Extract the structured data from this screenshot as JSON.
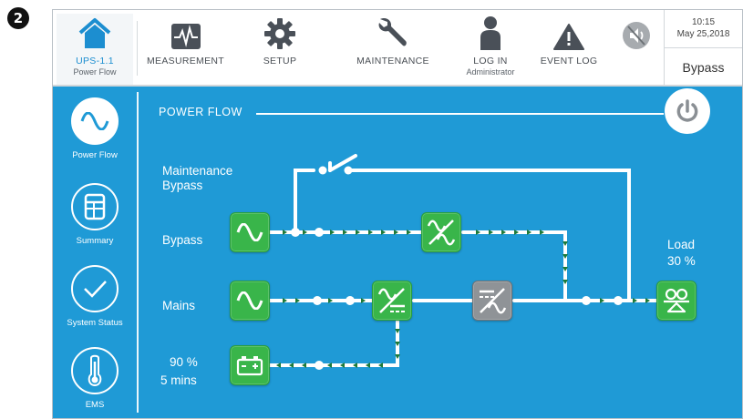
{
  "step_badge": "2",
  "topbar": {
    "items": [
      {
        "label": "UPS-1.1",
        "sublabel": "Power Flow",
        "icon": "home-icon",
        "active": true
      },
      {
        "label": "MEASUREMENT",
        "icon": "waveform-icon"
      },
      {
        "label": "SETUP",
        "icon": "gear-icon"
      },
      {
        "label": "MAINTENANCE",
        "icon": "wrench-icon"
      },
      {
        "label": "LOG IN",
        "sublabel": "Administrator",
        "icon": "user-icon"
      },
      {
        "label": "EVENT LOG",
        "icon": "warning-icon"
      },
      {
        "icon": "mute-icon"
      }
    ],
    "time": "10:15",
    "date": "May 25,2018",
    "mode": "Bypass"
  },
  "sidebar": {
    "items": [
      {
        "label": "Power Flow",
        "icon": "sine-wave-icon",
        "active": true
      },
      {
        "label": "Summary",
        "icon": "summary-table-icon"
      },
      {
        "label": "System Status",
        "icon": "checkmark-icon"
      },
      {
        "label": "EMS",
        "icon": "thermometer-icon"
      }
    ]
  },
  "power_flow": {
    "title": "POWER FLOW",
    "labels": {
      "maintenance_bypass_line1": "Maintenance",
      "maintenance_bypass_line2": "Bypass",
      "bypass": "Bypass",
      "mains": "Mains",
      "battery_charge": "90 %",
      "battery_time": "5 mins",
      "load_title": "Load",
      "load_value": "30 %"
    }
  },
  "colors": {
    "background_blue": "#1f9ad6",
    "block_green": "#39b54a",
    "inverter_grey": "#8f9397",
    "accent_blue": "#1c8ed0"
  }
}
